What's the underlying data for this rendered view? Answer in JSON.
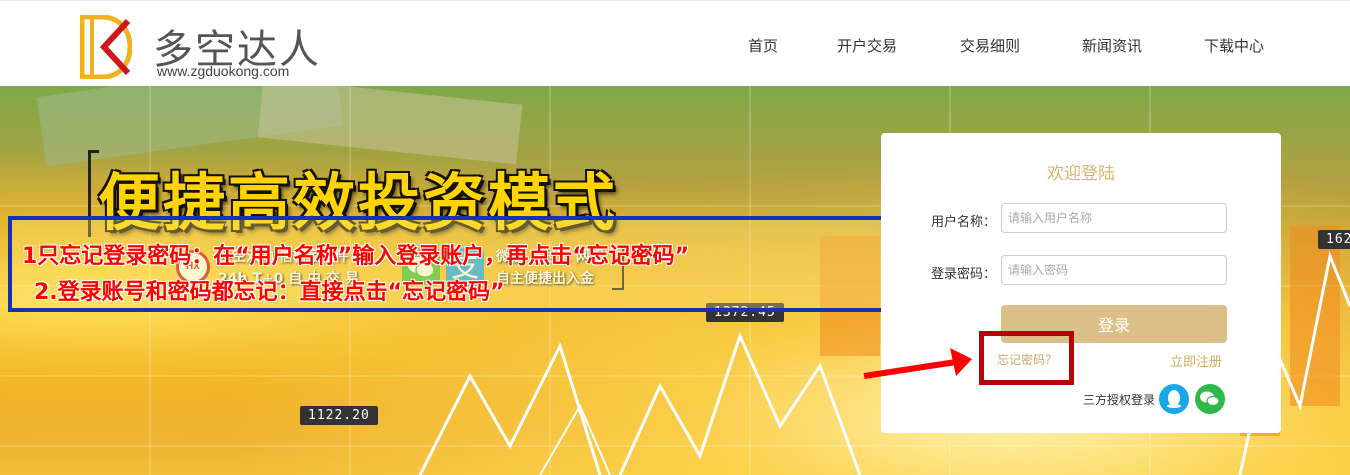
{
  "header": {
    "brand_name": "多空达人",
    "brand_url": "www.zgduokong.com",
    "nav": [
      {
        "label": "首页"
      },
      {
        "label": "开户交易"
      },
      {
        "label": "交易细则"
      },
      {
        "label": "新闻资讯"
      },
      {
        "label": "下载中心"
      }
    ]
  },
  "banner": {
    "slogan": "便捷高效投资模式",
    "feature_left": {
      "badge": "HX",
      "line1": "多空双向  信管家软件",
      "line2": "24h T+0  自 由 交 易"
    },
    "feature_right": {
      "alipay_glyph": "支",
      "line1": "微信 支付宝 网银",
      "line2": "自主便捷出入金"
    },
    "tickers": [
      "1372.45",
      "1122.20",
      "162"
    ]
  },
  "annotation": {
    "line1": "1只忘记登录密码：在“用户名称”输入登录账户，再点击“忘记密码”",
    "line2": "2.登录账号和密码都忘记：直接点击“忘记密码”"
  },
  "login": {
    "title": "欢迎登陆",
    "username_label": "用户名称：",
    "username_placeholder": "请输入用户名称",
    "password_label": "登录密码：",
    "password_placeholder": "请输入密码",
    "submit_label": "登录",
    "forgot_label": "忘记密码？",
    "register_label": "立即注册",
    "oauth_label": "三方授权登录",
    "oauth_qq_icon": "qq-icon",
    "oauth_wechat_icon": "wechat-icon"
  },
  "colors": {
    "accent_gold": "#dcc08a",
    "annotation_blue": "#1930b5",
    "annotation_red": "#ff0000",
    "highlight_red": "#b5040a",
    "qq_blue": "#1aa7e8",
    "wechat_green": "#2fb94a"
  }
}
